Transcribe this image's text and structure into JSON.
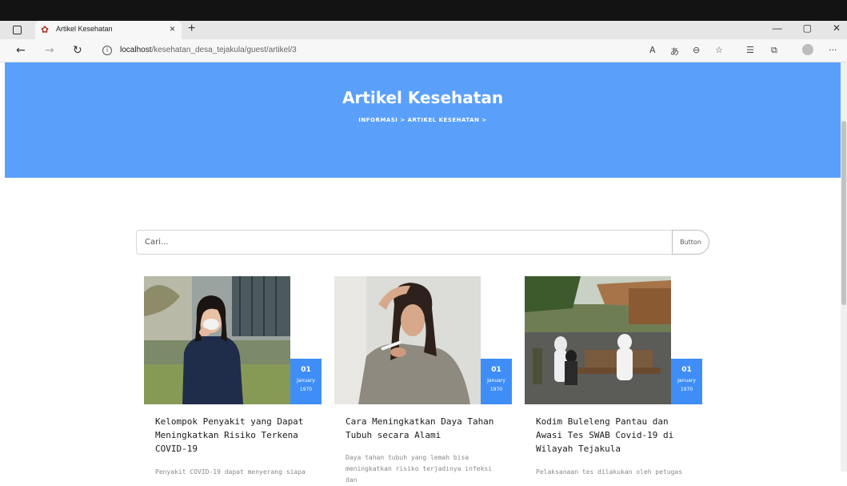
{
  "browser": {
    "tab_title": "Artikel Kesehatan",
    "tab_close": "×",
    "new_tab": "+",
    "url_host": "localhost",
    "url_path": "/kesehatan_desa_tejakula/guest/artikel/3",
    "win_minimize": "—",
    "win_restore": "▢",
    "win_close": "✕"
  },
  "hero": {
    "title": "Artikel Kesehatan",
    "breadcrumb": "INFORMASI >  ARTIKEL KESEHATAN >"
  },
  "search": {
    "placeholder": "Cari...",
    "button_label": "Button"
  },
  "articles": [
    {
      "day": "01",
      "month": "January",
      "year": "1970",
      "title": "Kelompok Penyakit yang Dapat Meningkatkan Risiko Terkena COVID-19",
      "excerpt": "Penyakit COVID-19 dapat menyerang siapa"
    },
    {
      "day": "01",
      "month": "January",
      "year": "1970",
      "title": "Cara Meningkatkan Daya Tahan Tubuh secara Alami",
      "excerpt": "Daya tahan tubuh yang lemah bisa meningkatkan risiko terjadinya infeksi dan"
    },
    {
      "day": "01",
      "month": "January",
      "year": "1970",
      "title": "Kodim Buleleng Pantau dan Awasi Tes SWAB Covid-19 di Wilayah Tejakula",
      "excerpt": "Pelaksanaan tes dilakukan oleh petugas"
    }
  ],
  "colors": {
    "hero_bg": "#5aa0fb",
    "badge_bg": "#3f8ef7"
  }
}
